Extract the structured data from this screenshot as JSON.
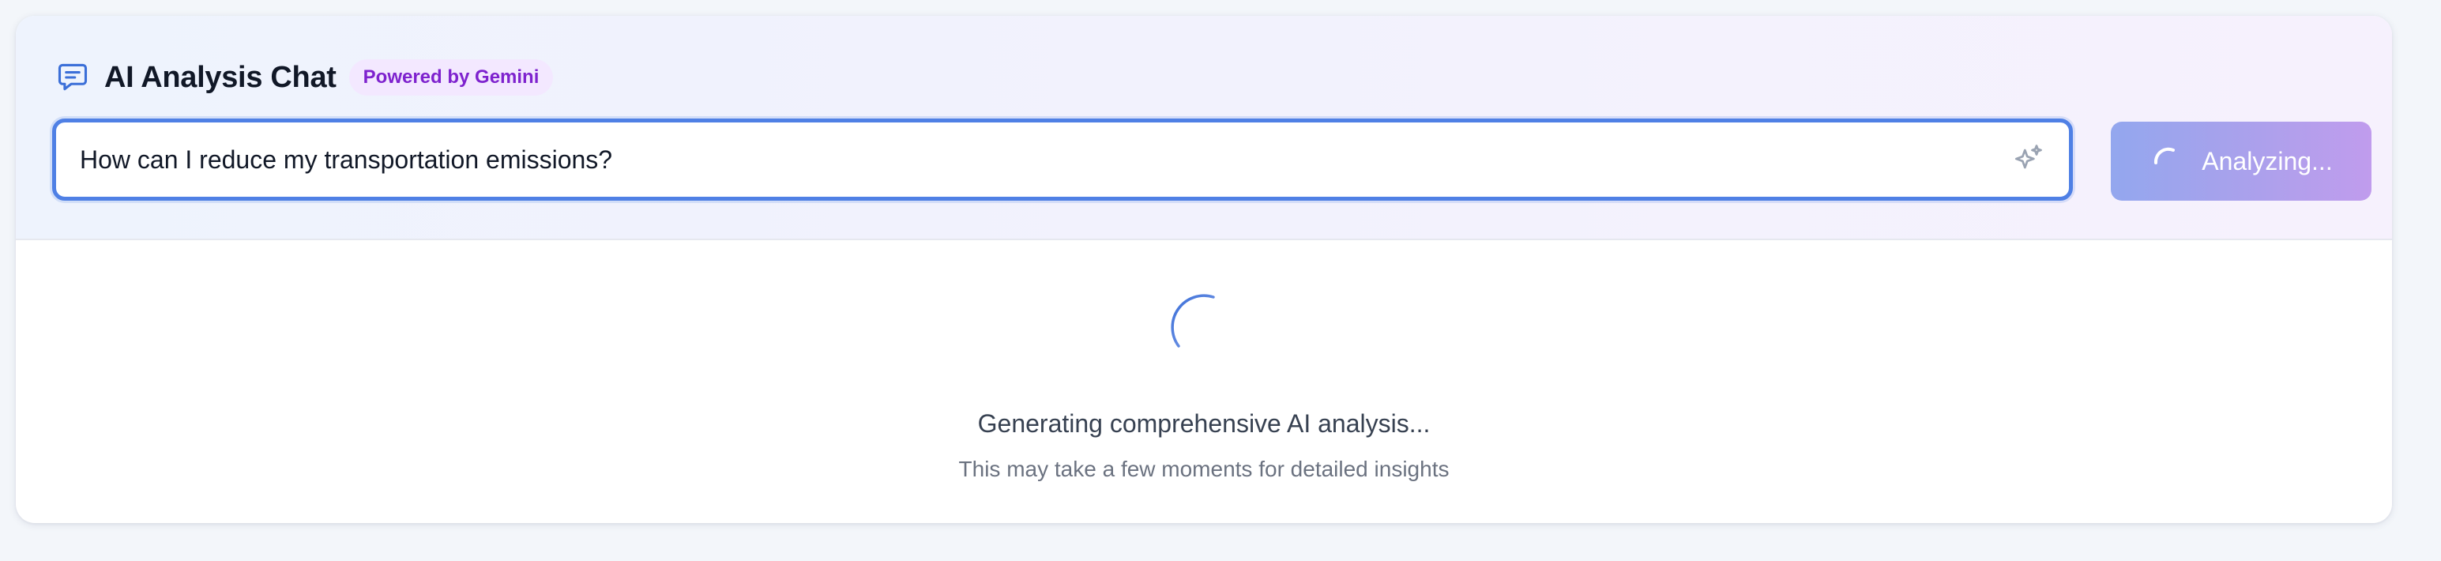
{
  "header": {
    "title": "AI Analysis Chat",
    "badge": "Powered by Gemini",
    "icon": "chat-bubble-icon"
  },
  "search": {
    "value": "How can I reduce my transportation emissions?",
    "icon": "sparkles-icon"
  },
  "action_button": {
    "label": "Analyzing...",
    "state": "loading",
    "icon": "spinner-icon"
  },
  "loading": {
    "title": "Generating comprehensive AI analysis...",
    "subtitle": "This may take a few moments for detailed insights"
  },
  "colors": {
    "accent": "#4f80e5",
    "badge_bg": "#f3e8ff",
    "badge_text": "#7e22ce",
    "button_gradient_start": "#93a7ee",
    "button_gradient_end": "#c09ced"
  }
}
